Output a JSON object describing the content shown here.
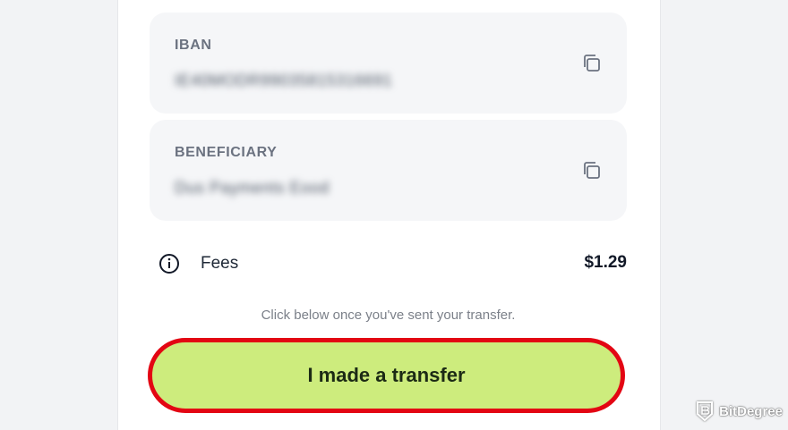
{
  "iban": {
    "label": "IBAN",
    "value": "IE40MODR99035815316691",
    "copy_icon": "copy-icon"
  },
  "beneficiary": {
    "label": "BENEFICIARY",
    "value": "Dus Payments Eood",
    "copy_icon": "copy-icon"
  },
  "fees": {
    "icon": "info-icon",
    "label": "Fees",
    "amount": "$1.29"
  },
  "hint": "Click below once you've sent your transfer.",
  "cta": {
    "label": "I made a transfer",
    "accent_color": "#cdec7d",
    "highlight_color": "#e30613"
  },
  "watermark": {
    "icon": "bitdegree-logo-icon",
    "text": "BitDegree"
  }
}
